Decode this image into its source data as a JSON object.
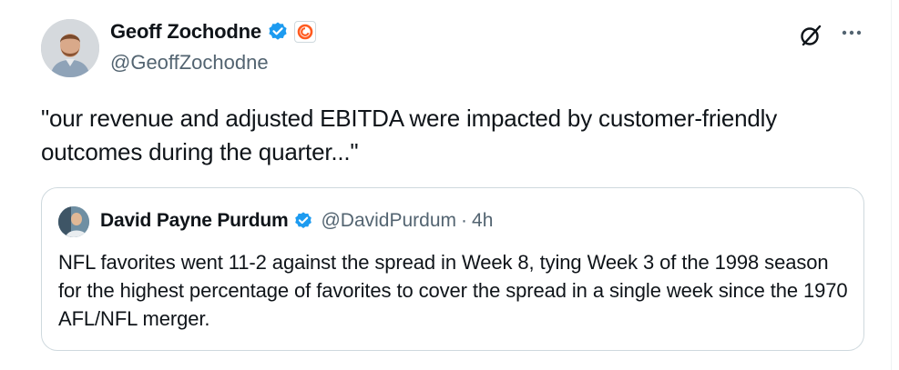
{
  "tweet": {
    "author_name": "Geoff Zochodne",
    "author_handle": "@GeoffZochodne",
    "text": "\"our revenue and adjusted EBITDA were impacted by customer-friendly outcomes during the quarter...\""
  },
  "quoted_tweet": {
    "author_name": "David Payne Purdum",
    "author_handle": "@DavidPurdum",
    "separator": "·",
    "time": "4h",
    "text": "NFL favorites went 11-2 against the spread in Week 8, tying Week 3 of the 1998 season for the highest percentage of favorites to cover the spread in a single week since the 1970 AFL/NFL merger."
  },
  "colors": {
    "verified_blue": "#1d9bf0",
    "secondary_text": "#536471",
    "border": "#cfd9de",
    "affiliate_orange": "#ff5a1f"
  },
  "icons": {
    "verified": "verified-badge-icon",
    "affiliate": "affiliate-logo-icon",
    "grok": "grok-icon",
    "more": "more-dots-icon"
  }
}
